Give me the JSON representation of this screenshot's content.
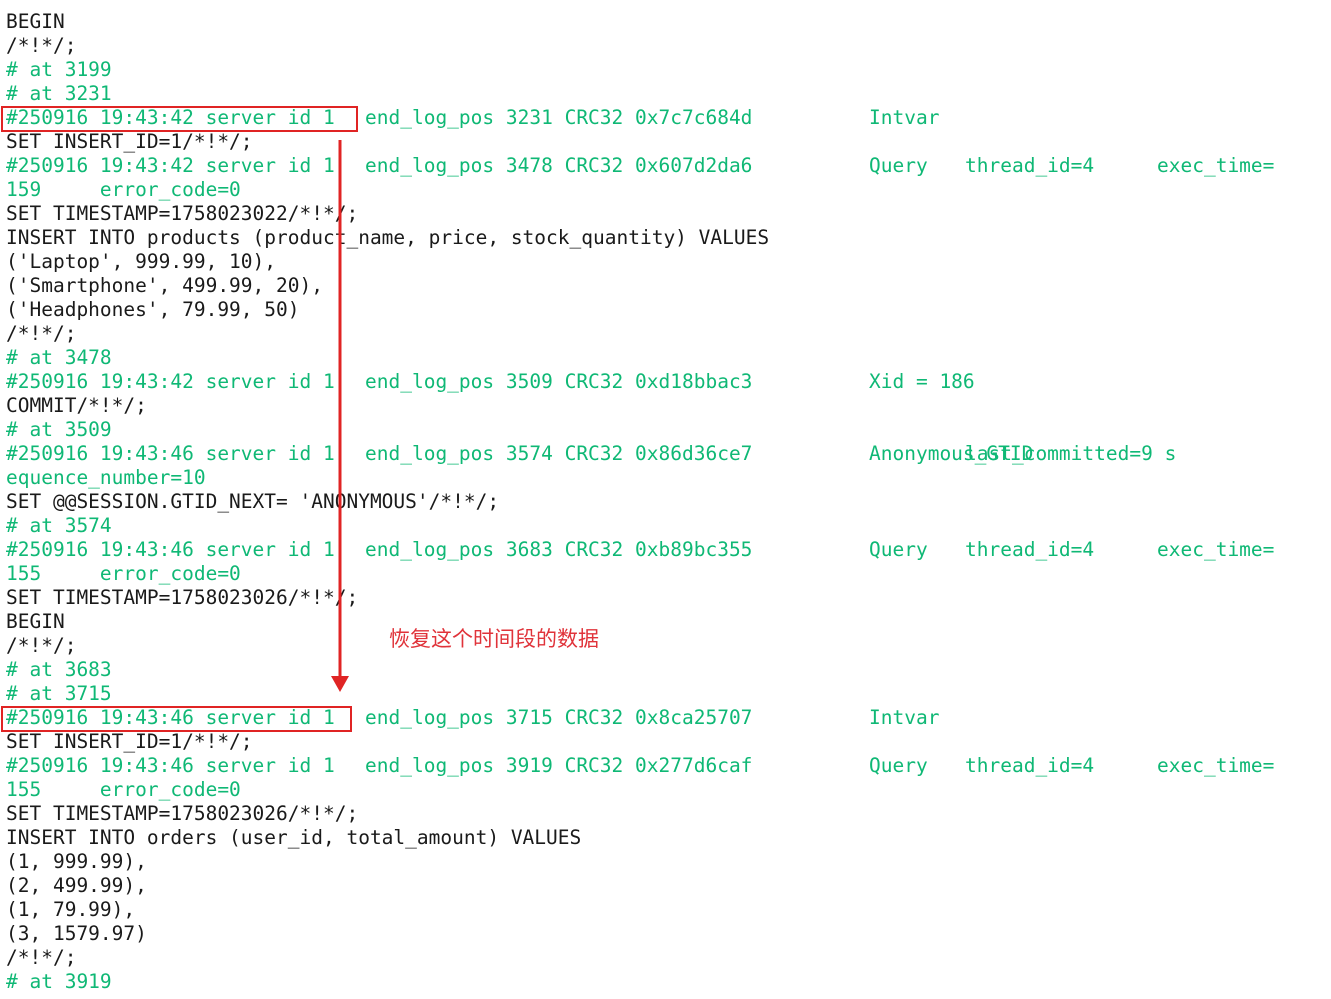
{
  "colors": {
    "background": "#ffffff",
    "text": "#1a1a1a",
    "header": "#0fb875",
    "highlight": "#e02424"
  },
  "lines": [
    {
      "t": "plain",
      "text": "BEGIN"
    },
    {
      "t": "plain",
      "text": "/*!*/;"
    },
    {
      "t": "comment",
      "text": "# at 3199"
    },
    {
      "t": "comment",
      "text": "# at 3231"
    },
    {
      "t": "header",
      "a": "#250916 19:43:42 server id 1",
      "b": "end_log_pos 3231 CRC32 0x7c7c684d",
      "c": "Intvar",
      "d": "",
      "e": ""
    },
    {
      "t": "plain",
      "text": "SET INSERT_ID=1/*!*/;"
    },
    {
      "t": "header",
      "a": "#250916 19:43:42 server id 1",
      "b": "end_log_pos 3478 CRC32 0x607d2da6",
      "c": "Query",
      "d": "thread_id=4",
      "e": "exec_time="
    },
    {
      "t": "comment",
      "text": "159     error_code=0"
    },
    {
      "t": "plain",
      "text": "SET TIMESTAMP=1758023022/*!*/;"
    },
    {
      "t": "plain",
      "text": "INSERT INTO products (product_name, price, stock_quantity) VALUES"
    },
    {
      "t": "plain",
      "text": "('Laptop', 999.99, 10),"
    },
    {
      "t": "plain",
      "text": "('Smartphone', 499.99, 20),"
    },
    {
      "t": "plain",
      "text": "('Headphones', 79.99, 50)"
    },
    {
      "t": "plain",
      "text": "/*!*/;"
    },
    {
      "t": "comment",
      "text": "# at 3478"
    },
    {
      "t": "header",
      "a": "#250916 19:43:42 server id 1",
      "b": "end_log_pos 3509 CRC32 0xd18bbac3",
      "c": "Xid = 186",
      "d": "",
      "e": ""
    },
    {
      "t": "plain",
      "text": "COMMIT/*!*/;"
    },
    {
      "t": "comment",
      "text": "# at 3509"
    },
    {
      "t": "header",
      "a": "#250916 19:43:46 server id 1",
      "b": "end_log_pos 3574 CRC32 0x86d36ce7",
      "c": "Anonymous_GTID",
      "d": "last_committed=9 s",
      "e": ""
    },
    {
      "t": "comment",
      "text": "equence_number=10"
    },
    {
      "t": "plain",
      "text": "SET @@SESSION.GTID_NEXT= 'ANONYMOUS'/*!*/;"
    },
    {
      "t": "comment",
      "text": "# at 3574"
    },
    {
      "t": "header",
      "a": "#250916 19:43:46 server id 1",
      "b": "end_log_pos 3683 CRC32 0xb89bc355",
      "c": "Query",
      "d": "thread_id=4",
      "e": "exec_time="
    },
    {
      "t": "comment",
      "text": "155     error_code=0"
    },
    {
      "t": "plain",
      "text": "SET TIMESTAMP=1758023026/*!*/;"
    },
    {
      "t": "plain",
      "text": "BEGIN"
    },
    {
      "t": "plain",
      "text": "/*!*/;"
    },
    {
      "t": "comment",
      "text": "# at 3683"
    },
    {
      "t": "comment",
      "text": "# at 3715"
    },
    {
      "t": "header",
      "a": "#250916 19:43:46 server id 1",
      "b": "end_log_pos 3715 CRC32 0x8ca25707",
      "c": "Intvar",
      "d": "",
      "e": ""
    },
    {
      "t": "plain",
      "text": "SET INSERT_ID=1/*!*/;"
    },
    {
      "t": "header",
      "a": "#250916 19:43:46 server id 1",
      "b": "end_log_pos 3919 CRC32 0x277d6caf",
      "c": "Query",
      "d": "thread_id=4",
      "e": "exec_time="
    },
    {
      "t": "comment",
      "text": "155     error_code=0"
    },
    {
      "t": "plain",
      "text": "SET TIMESTAMP=1758023026/*!*/;"
    },
    {
      "t": "plain",
      "text": "INSERT INTO orders (user_id, total_amount) VALUES"
    },
    {
      "t": "plain",
      "text": "(1, 999.99),"
    },
    {
      "t": "plain",
      "text": "(2, 499.99),"
    },
    {
      "t": "plain",
      "text": "(1, 79.99),"
    },
    {
      "t": "plain",
      "text": "(3, 1579.97)"
    },
    {
      "t": "plain",
      "text": "/*!*/;"
    },
    {
      "t": "comment",
      "text": "# at 3919"
    }
  ],
  "annotation": {
    "text": "恢复这个时间段的数据"
  }
}
